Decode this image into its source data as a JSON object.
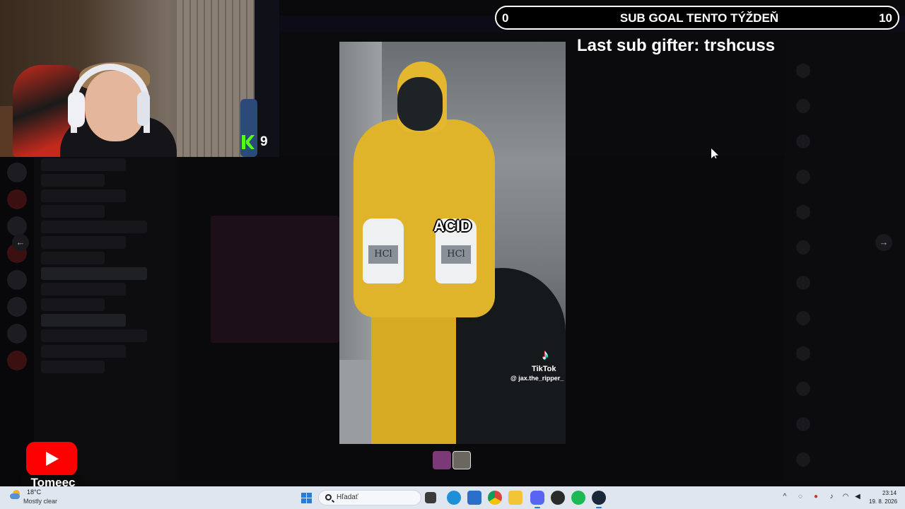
{
  "webcam": {
    "kick_viewers": "9"
  },
  "sub_goal": {
    "current": "0",
    "title": "SUB GOAL TENTO TÝŽDEŇ",
    "target": "10"
  },
  "last_sub_gifter": "Last sub gifter: trshcuss",
  "media_viewer": {
    "caption": "ACID",
    "jug_label": "HCl",
    "watermark_name": "TikTok",
    "watermark_handle": "@ jax.the_ripper_",
    "prev_icon": "arrow-left-icon",
    "next_icon": "arrow-right-icon",
    "thumbnail_count": 2
  },
  "youtube_badge": {
    "channel": "Tomeec"
  },
  "taskbar": {
    "weather_temp": "18°C",
    "weather_desc": "Mostly clear",
    "search_placeholder": "Hľadať",
    "apps": [
      "task-view-icon",
      "edge-icon",
      "mail-icon",
      "chrome-icon",
      "file-explorer-icon",
      "discord-icon",
      "obs-icon",
      "spotify-icon",
      "steam-icon"
    ],
    "clock_time": "23:14",
    "clock_date": "19. 8. 2026"
  },
  "colors": {
    "kick_green": "#53fc18",
    "youtube_red": "#ff0000",
    "hazmat_yellow": "#e0b42a",
    "taskbar": "#dfe6f0"
  }
}
